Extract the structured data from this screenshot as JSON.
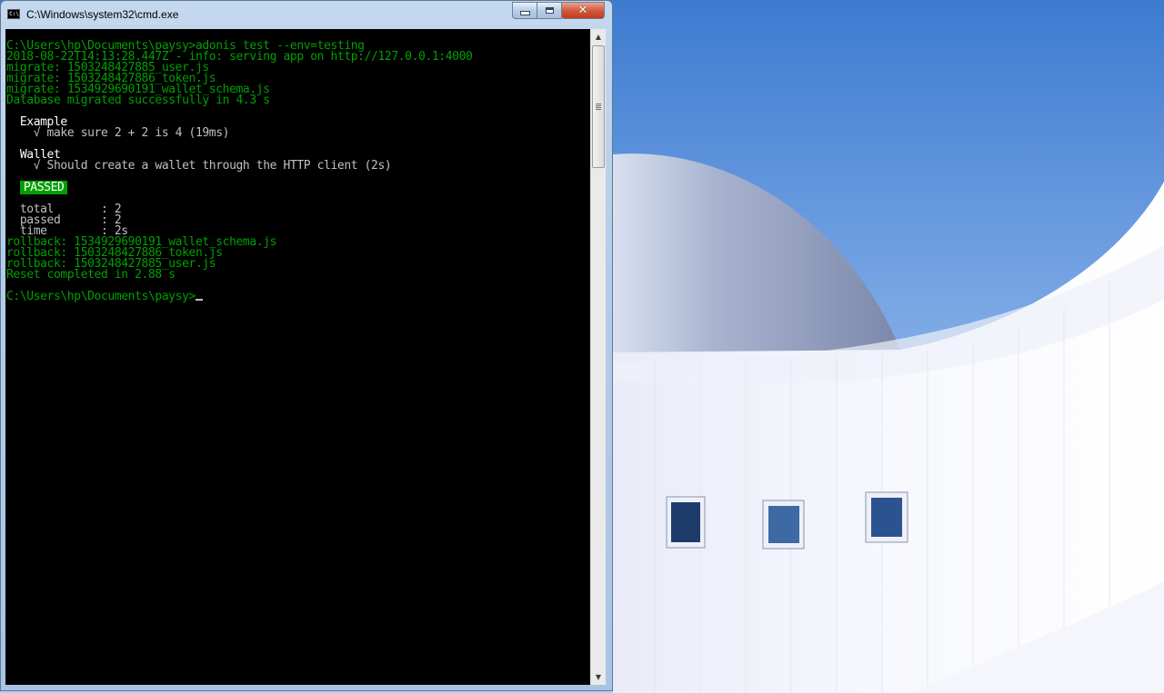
{
  "window": {
    "title": "C:\\Windows\\system32\\cmd.exe",
    "icon": "cmd-icon",
    "icon_text": "C:\\",
    "controls": {
      "minimize": "minimize-icon",
      "maximize": "maximize-icon",
      "close": "close-icon",
      "close_glyph": "✕"
    }
  },
  "console": {
    "lines": [
      {
        "text": "C:\\Users\\hp\\Documents\\paysy>adonis test --env=testing",
        "color": "green"
      },
      {
        "text": "2018-08-22T14:13:28.447Z - info: serving app on http://127.0.0.1:4000",
        "color": "green"
      },
      {
        "text": "migrate: 1503248427885_user.js",
        "color": "green"
      },
      {
        "text": "migrate: 1503248427886_token.js",
        "color": "green"
      },
      {
        "text": "migrate: 1534929690191_wallet_schema.js",
        "color": "green"
      },
      {
        "text": "Database migrated successfully in 4.3 s",
        "color": "green"
      },
      {
        "text": "",
        "color": "green"
      },
      {
        "text": "  Example",
        "color": "white"
      },
      {
        "text": "    √ make sure 2 + 2 is 4 (19ms)",
        "color": "gray",
        "check": true
      },
      {
        "text": "",
        "color": "green"
      },
      {
        "text": "  Wallet",
        "color": "white"
      },
      {
        "text": "    √ Should create a wallet through the HTTP client (2s)",
        "color": "gray",
        "check": true
      },
      {
        "text": "",
        "color": "green"
      },
      {
        "text": "PASSED",
        "color": "badge"
      },
      {
        "text": "",
        "color": "green"
      },
      {
        "text": "  total       : 2",
        "color": "gray"
      },
      {
        "text": "  passed      : 2",
        "color": "gray"
      },
      {
        "text": "  time        : 2s",
        "color": "gray"
      },
      {
        "text": "rollback: 1534929690191_wallet_schema.js",
        "color": "green"
      },
      {
        "text": "rollback: 1503248427886_token.js",
        "color": "green"
      },
      {
        "text": "rollback: 1503248427885_user.js",
        "color": "green"
      },
      {
        "text": "Reset completed in 2.88 s",
        "color": "green"
      },
      {
        "text": "",
        "color": "green"
      },
      {
        "text": "C:\\Users\\hp\\Documents\\paysy>",
        "color": "green",
        "cursor": true
      }
    ]
  },
  "scrollbar": {
    "up": "▲",
    "down": "▼",
    "up_icon": "scroll-up-arrow-icon",
    "down_icon": "scroll-down-arrow-icon"
  },
  "colors": {
    "green": "#00a000",
    "gray": "#c0c0c0",
    "white": "#ffffff",
    "background": "#000000"
  }
}
